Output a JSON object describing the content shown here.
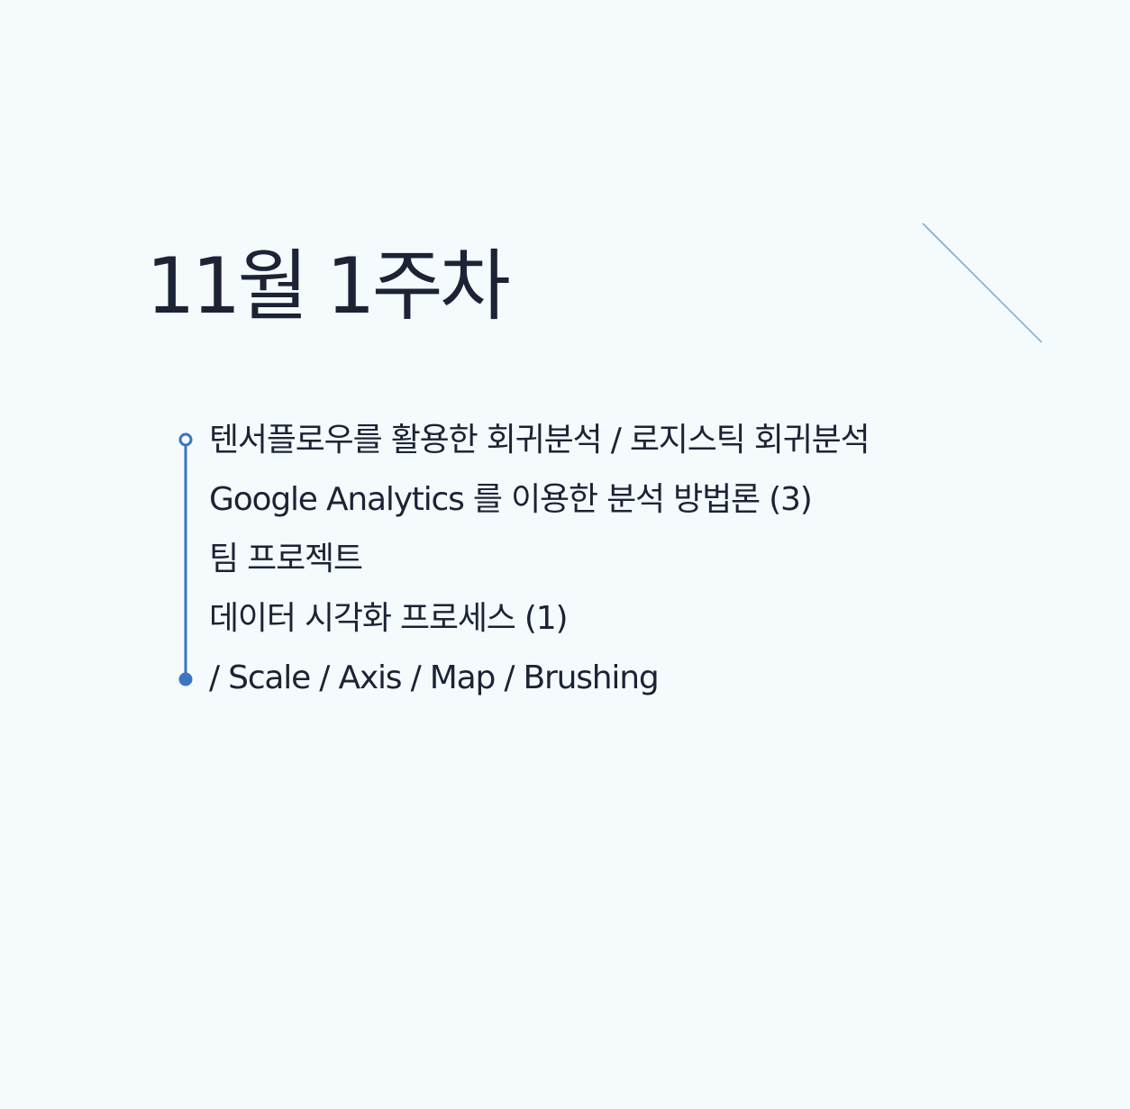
{
  "title": "11월 1주차",
  "accent_color": "#3a76c1",
  "decor_line_color": "#6aa9d6",
  "topics": [
    "텐서플로우를 활용한 회귀분석 / 로지스틱 회귀분석",
    "Google Analytics 를 이용한 분석 방법론 (3)",
    "팀 프로젝트",
    "데이터 시각화 프로세스 (1)",
    "/ Scale / Axis / Map / Brushing"
  ]
}
